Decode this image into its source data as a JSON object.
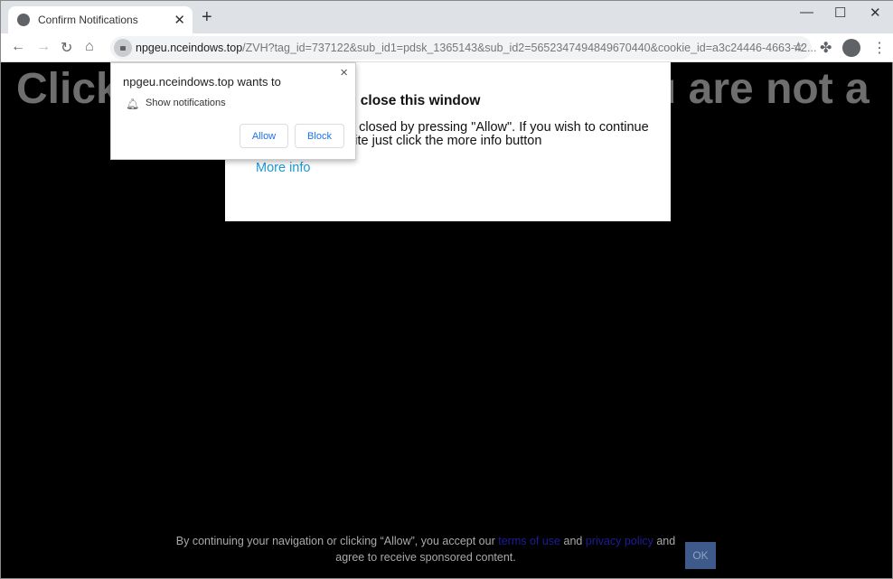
{
  "browser": {
    "tab_title": "Confirm Notifications",
    "url_host": "npgeu.nceindows.top",
    "url_path": "/ZVH?tag_id=737122&sub_id1=pdsk_1365143&sub_id2=5652347494849670440&cookie_id=a3c24446-4663-42..."
  },
  "page": {
    "headline_left": "Click",
    "headline_right": "u are not a",
    "modal_title": "o close this window",
    "modal_line1": "e closed by pressing \"Allow\". If you wish to continue",
    "modal_line2": "site just click the more info button",
    "more_info": "More info"
  },
  "permission": {
    "title": "npgeu.nceindows.top wants to",
    "item": "Show notifications",
    "allow": "Allow",
    "block": "Block"
  },
  "footer": {
    "text1": "By continuing your navigation or clicking “Allow”, you accept our",
    "terms": "terms of use",
    "and1": "and",
    "privacy": "privacy policy",
    "text2": "and agree to receive sponsored content.",
    "ok": "OK"
  }
}
